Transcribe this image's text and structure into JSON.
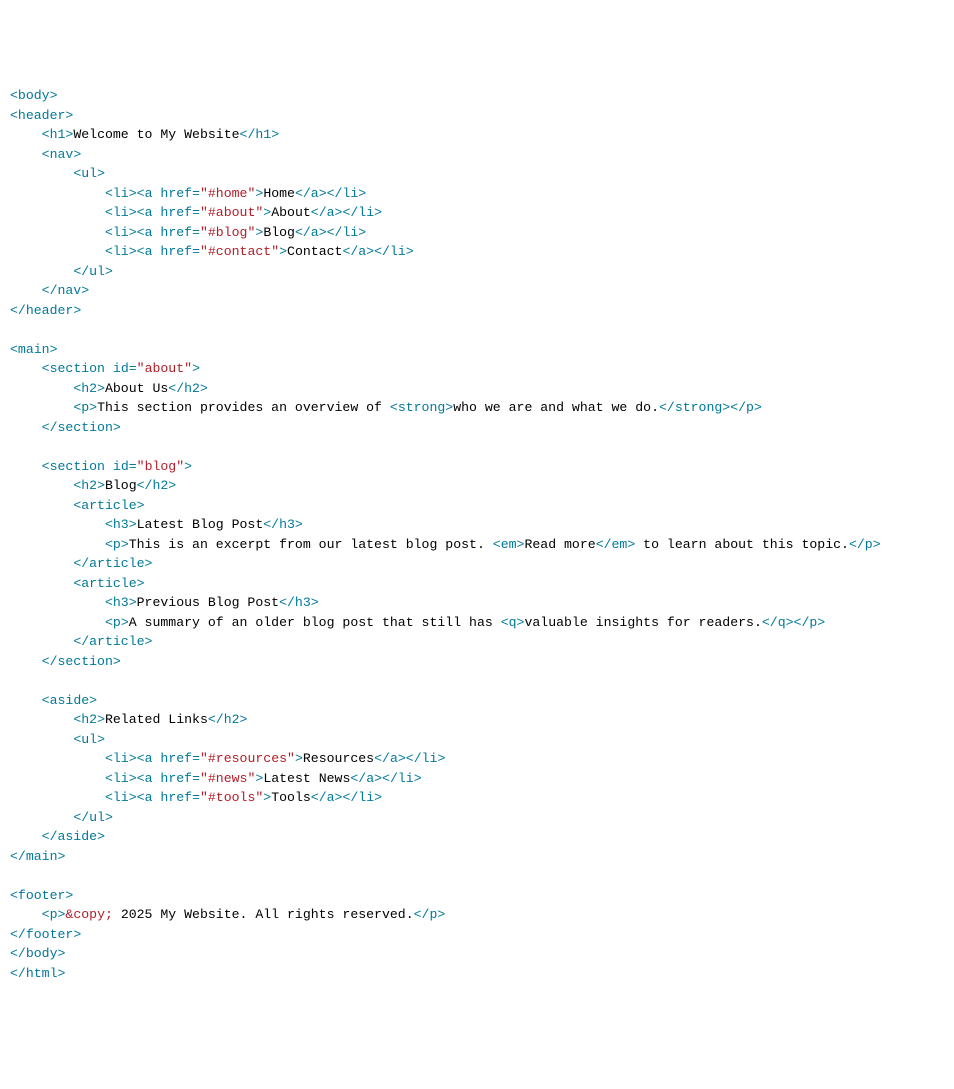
{
  "tokens": {
    "lt": "<",
    "gt": ">",
    "lts": "</",
    "eq": "=",
    "q": "\""
  },
  "tags": {
    "body": "body",
    "header": "header",
    "h1": "h1",
    "nav": "nav",
    "ul": "ul",
    "li": "li",
    "a": "a",
    "main": "main",
    "section": "section",
    "h2": "h2",
    "p": "p",
    "strong": "strong",
    "article": "article",
    "h3": "h3",
    "em": "em",
    "qtag": "q",
    "aside": "aside",
    "footer": "footer",
    "html": "html"
  },
  "attrs": {
    "href": "href",
    "id": "id"
  },
  "vals": {
    "home": "\"#home\"",
    "about": "\"#about\"",
    "blog": "\"#blog\"",
    "contact": "\"#contact\"",
    "aboutId": "\"about\"",
    "blogId": "\"blog\"",
    "resources": "\"#resources\"",
    "news": "\"#news\"",
    "tools": "\"#tools\""
  },
  "txt": {
    "welcome": "Welcome to My Website",
    "home": "Home",
    "about": "About",
    "blog": "Blog",
    "contact": "Contact",
    "aboutUs": "About Us",
    "aboutP1": "This section provides an overview of ",
    "aboutStrong": "who we are and what we do.",
    "blogH2": "Blog",
    "art1H3": "Latest Blog Post",
    "art1P1": "This is an excerpt from our latest blog post. ",
    "art1Em": "Read more",
    "art1P2": " to learn about this topic.",
    "art2H3": "Previous Blog Post",
    "art2P1": "A summary of an older blog post that still has ",
    "art2Q": "valuable insights for readers.",
    "relLinks": "Related Links",
    "resources": "Resources",
    "news": "Latest News",
    "tools": "Tools",
    "copyEnt": "&copy;",
    "footerRest": " 2025 My Website. All rights reserved."
  }
}
